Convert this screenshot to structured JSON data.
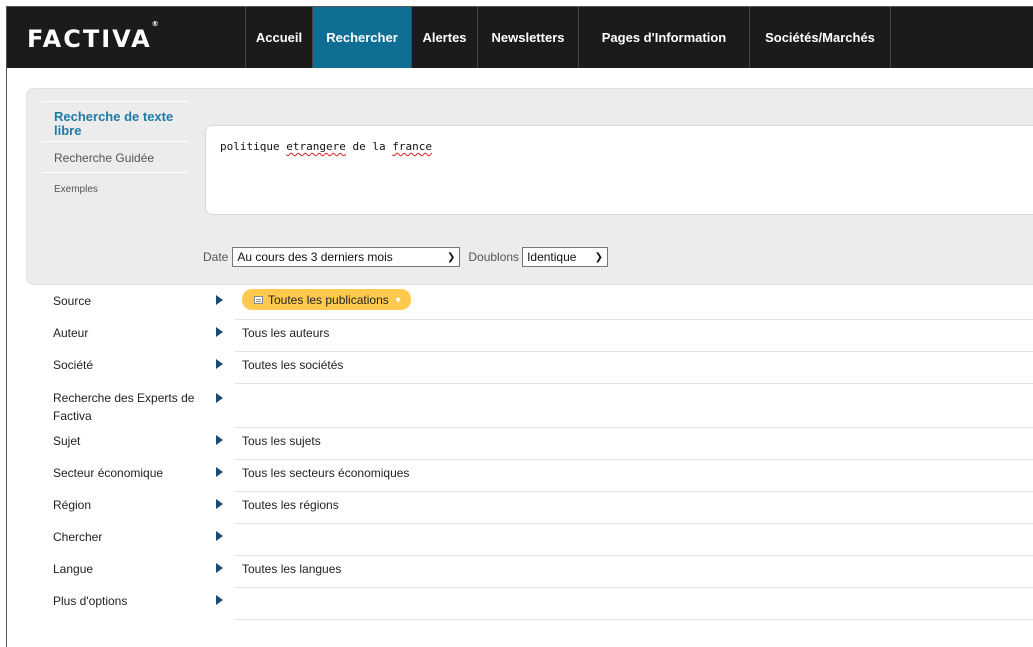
{
  "brand": {
    "name": "FACTIVA",
    "mark": "®"
  },
  "nav": {
    "items": [
      {
        "label": "Accueil",
        "active": false
      },
      {
        "label": "Rechercher",
        "active": true
      },
      {
        "label": "Alertes",
        "active": false
      },
      {
        "label": "Newsletters",
        "active": false
      },
      {
        "label": "Pages d'Information",
        "active": false
      },
      {
        "label": "Sociétés/Marchés",
        "active": false
      }
    ]
  },
  "search": {
    "modes": {
      "free_text": "Recherche de texte libre",
      "guided": "Recherche Guidée",
      "examples": "Exemples"
    },
    "query": {
      "part1": "politique ",
      "word1": "etrangere",
      "part2": " de la ",
      "word2": "france"
    },
    "date_label": "Date",
    "date_value": "Au cours des 3 derniers mois",
    "duplicates_label": "Doublons",
    "duplicates_value": "Identique"
  },
  "filters": [
    {
      "label": "Source",
      "value": "Toutes les publications"
    },
    {
      "label": "Auteur",
      "value": "Tous les auteurs"
    },
    {
      "label": "Société",
      "value": "Toutes les sociétés"
    },
    {
      "label": "Recherche des Experts de Factiva",
      "value": ""
    },
    {
      "label": "Sujet",
      "value": "Tous les sujets"
    },
    {
      "label": "Secteur économique",
      "value": "Tous les secteurs économiques"
    },
    {
      "label": "Région",
      "value": "Toutes les régions"
    },
    {
      "label": "Chercher",
      "value": ""
    },
    {
      "label": "Langue",
      "value": "Toutes les langues"
    },
    {
      "label": "Plus d'options",
      "value": ""
    }
  ],
  "colors": {
    "nav_bg": "#1b1b1b",
    "nav_active": "#0f6e93",
    "link": "#1e7aa8",
    "pill": "#ffc94d",
    "arrow": "#1b4a72"
  }
}
